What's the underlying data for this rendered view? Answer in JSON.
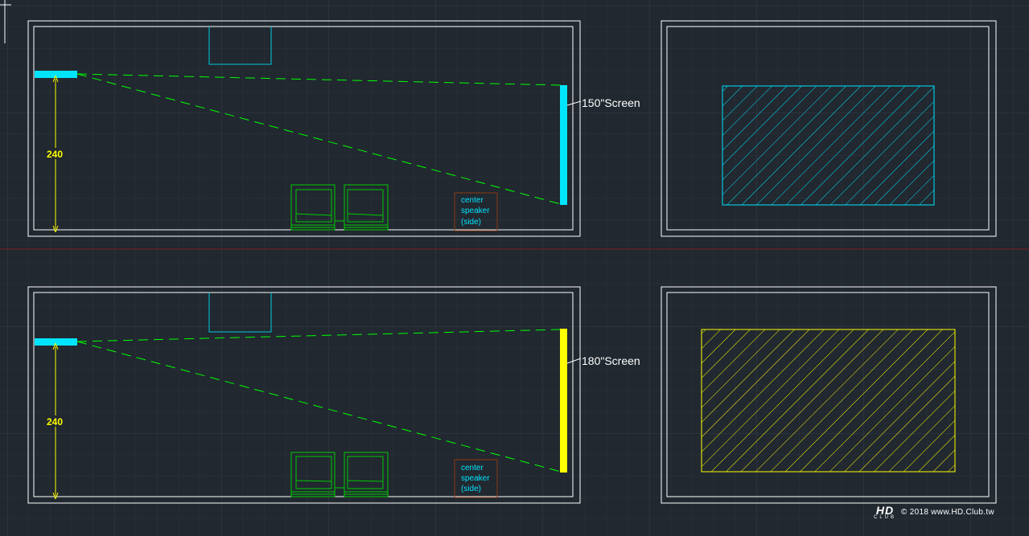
{
  "colors": {
    "background": "#212830",
    "grid_minor": "#2b323b",
    "grid_major": "#343c47",
    "wall": "#ffffff",
    "beam": "#00ff00",
    "projector": "#00e5ff",
    "screen_150": "#00e5ff",
    "screen_180": "#ffff00",
    "dimension": "#ffff00",
    "seat": "#00cc00",
    "speaker_box": "#8b3a10",
    "speaker_text": "#00e5ff",
    "axis_line": "#7a1e1e"
  },
  "icons": {
    "ucs": "ucs-crosshair-icon",
    "projector": "projector-icon",
    "seat": "seat-icon"
  },
  "panels": [
    {
      "id": "top",
      "screen_label": "150\"Screen",
      "screen_color": "#00e5ff",
      "dimension_label": "240",
      "speaker_lines": [
        "center",
        "speaker",
        "(side)"
      ]
    },
    {
      "id": "bottom",
      "screen_label": "180\"Screen",
      "screen_color": "#ffff00",
      "dimension_label": "240",
      "speaker_lines": [
        "center",
        "speaker",
        "(side)"
      ]
    }
  ],
  "footer": {
    "logo_main": "HD",
    "logo_sub": "CLUB",
    "copyright": "© 2018 www.HD.Club.tw"
  }
}
